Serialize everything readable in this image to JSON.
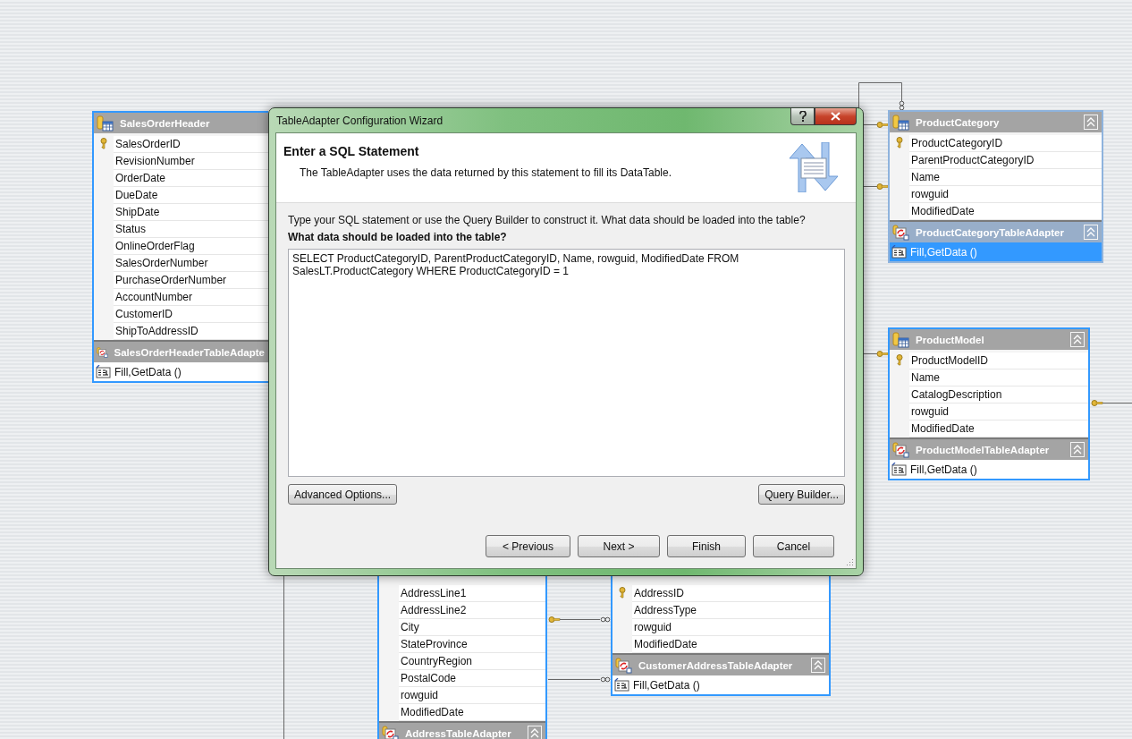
{
  "designer": {
    "tables": [
      {
        "name": "SalesOrderHeader",
        "columns": [
          {
            "name": "SalesOrderID",
            "key": true
          },
          {
            "name": "RevisionNumber",
            "key": false
          },
          {
            "name": "OrderDate",
            "key": false
          },
          {
            "name": "DueDate",
            "key": false
          },
          {
            "name": "ShipDate",
            "key": false
          },
          {
            "name": "Status",
            "key": false
          },
          {
            "name": "OnlineOrderFlag",
            "key": false
          },
          {
            "name": "SalesOrderNumber",
            "key": false
          },
          {
            "name": "PurchaseOrderNumber",
            "key": false
          },
          {
            "name": "AccountNumber",
            "key": false
          },
          {
            "name": "CustomerID",
            "key": false
          },
          {
            "name": "ShipToAddressID",
            "key": false
          }
        ],
        "adapter": {
          "name": "SalesOrderHeaderTableAdapte",
          "methods": [
            {
              "label": "Fill,GetData ()",
              "selected": false
            }
          ]
        }
      },
      {
        "name": "ProductCategory",
        "columns": [
          {
            "name": "ProductCategoryID",
            "key": true
          },
          {
            "name": "ParentProductCategoryID",
            "key": false
          },
          {
            "name": "Name",
            "key": false
          },
          {
            "name": "rowguid",
            "key": false
          },
          {
            "name": "ModifiedDate",
            "key": false
          }
        ],
        "adapter": {
          "name": "ProductCategoryTableAdapter",
          "methods": [
            {
              "label": "Fill,GetData ()",
              "selected": true
            }
          ]
        }
      },
      {
        "name": "ProductModel",
        "columns": [
          {
            "name": "ProductModelID",
            "key": true
          },
          {
            "name": "Name",
            "key": false
          },
          {
            "name": "CatalogDescription",
            "key": false
          },
          {
            "name": "rowguid",
            "key": false
          },
          {
            "name": "ModifiedDate",
            "key": false
          }
        ],
        "adapter": {
          "name": "ProductModelTableAdapter",
          "methods": [
            {
              "label": "Fill,GetData ()",
              "selected": false
            }
          ]
        }
      },
      {
        "columns": [
          {
            "name": "AddressLine1",
            "key": false
          },
          {
            "name": "AddressLine2",
            "key": false
          },
          {
            "name": "City",
            "key": false
          },
          {
            "name": "StateProvince",
            "key": false
          },
          {
            "name": "CountryRegion",
            "key": false
          },
          {
            "name": "PostalCode",
            "key": false
          },
          {
            "name": "rowguid",
            "key": false
          },
          {
            "name": "ModifiedDate",
            "key": false
          }
        ],
        "adapter": {
          "name": "AddressTableAdapter"
        }
      },
      {
        "columns": [
          {
            "name": "AddressID",
            "key": true
          },
          {
            "name": "AddressType",
            "key": false
          },
          {
            "name": "rowguid",
            "key": false
          },
          {
            "name": "ModifiedDate",
            "key": false
          }
        ],
        "adapter": {
          "name": "CustomerAddressTableAdapter",
          "methods": [
            {
              "label": "Fill,GetData ()",
              "selected": false
            }
          ]
        }
      }
    ]
  },
  "dialog": {
    "title": "TableAdapter Configuration Wizard",
    "heading": "Enter a SQL Statement",
    "description": "The TableAdapter uses the data returned by this statement to fill its DataTable.",
    "instruction": "Type your SQL statement or use the Query Builder to construct it. What data should be loaded into the table?",
    "field_label": "What data should be loaded into the table?",
    "sql": "SELECT ProductCategoryID, ParentProductCategoryID, Name, rowguid, ModifiedDate FROM\nSalesLT.ProductCategory WHERE ProductCategoryID = 1",
    "side_buttons": [
      "Advanced Options...",
      "Query Builder..."
    ],
    "nav_buttons": [
      "< Previous",
      "Next >",
      "Finish",
      "Cancel"
    ]
  }
}
